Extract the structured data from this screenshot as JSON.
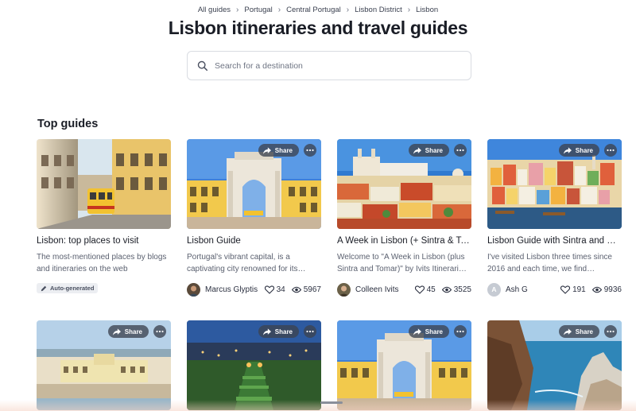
{
  "breadcrumb": [
    "All guides",
    "Portugal",
    "Central Portugal",
    "Lisbon District",
    "Lisbon"
  ],
  "page_title": "Lisbon itineraries and travel guides",
  "search": {
    "placeholder": "Search for a destination"
  },
  "section_title": "Top guides",
  "share_label": "Share",
  "cards": [
    {
      "title": "Lisbon: top places to visit",
      "description": "The most-mentioned places by blogs and itineraries on the web",
      "badge": "Auto-generated",
      "author": "",
      "likes": "",
      "views": "",
      "image": "tram-street"
    },
    {
      "title": "Lisbon Guide",
      "description": "Portugal's vibrant capital, is a captivating city renowned for its…",
      "badge": "",
      "author": "Marcus Glyptis",
      "likes": "34",
      "views": "5967",
      "image": "arch"
    },
    {
      "title": "A Week in Lisbon (+ Sintra & To…",
      "description": "Welcome to \"A Week in Lisbon (plus Sintra and Tomar)\" by Ivits Itinerari…",
      "badge": "",
      "author": "Colleen Ivits",
      "likes": "45",
      "views": "3525",
      "image": "hillside"
    },
    {
      "title": "Lisbon Guide with Sintra and C…",
      "description": "I've visited Lisbon three times since 2016 and each time, we find…",
      "badge": "",
      "author": "Ash G",
      "avatar_letter": "A",
      "likes": "191",
      "views": "9936",
      "image": "riverside"
    },
    {
      "title": "",
      "description": "",
      "image": "waterfront"
    },
    {
      "title": "",
      "description": "",
      "image": "night-garden"
    },
    {
      "title": "",
      "description": "",
      "image": "arch"
    },
    {
      "title": "",
      "description": "",
      "image": "coast"
    }
  ],
  "colors": {
    "accent": "#1a1d26",
    "pill_bg": "#3c4250",
    "badge_bg": "#eceef2"
  }
}
